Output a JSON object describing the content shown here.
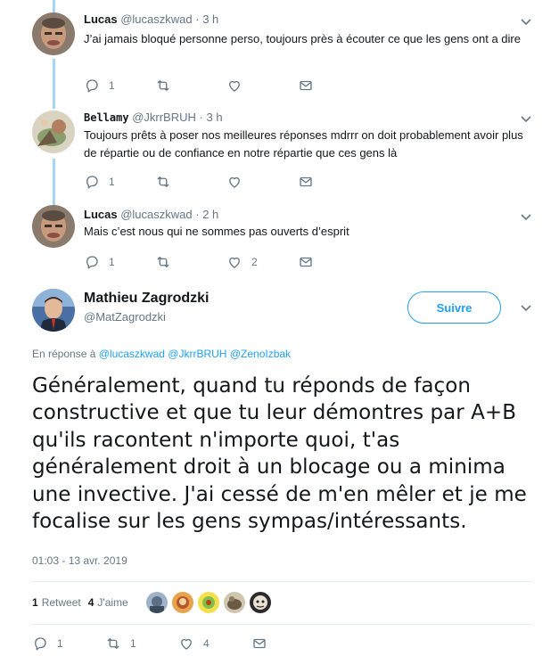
{
  "replies": [
    {
      "name": "Lucas",
      "handle": "@lucaszkwad",
      "dot": "·",
      "time": "3 h",
      "text": "J’ai jamais bloqué personne perso, toujours près à écouter ce que les gens ont a dire",
      "replies_count": "1",
      "retweets_count": "",
      "likes_count": ""
    },
    {
      "name": "Bellamy",
      "handle": "@JkrrBRUH",
      "dot": "·",
      "time": "3 h",
      "text": "Toujours prêts à poser nos meilleures réponses mdrrr on doit probablement avoir plus de répartie ou de confiance en notre répartie que ces gens là",
      "replies_count": "1",
      "retweets_count": "",
      "likes_count": ""
    },
    {
      "name": "Lucas",
      "handle": "@lucaszkwad",
      "dot": "·",
      "time": "2 h",
      "text": "Mais c’est nous qui ne sommes pas ouverts d’esprit",
      "replies_count": "1",
      "retweets_count": "",
      "likes_count": "2"
    }
  ],
  "main": {
    "name": "Mathieu Zagrodzki",
    "handle": "@MatZagrodzki",
    "follow_label": "Suivre",
    "in_reply_prefix": "En réponse à",
    "mentions": [
      "@lucaszkwad",
      "@JkrrBRUH",
      "@ZenoIzbak"
    ],
    "text": "Généralement, quand tu réponds de façon constructive et que tu leur démontres par A+B qu'ils racontent n'importe quoi, t'as généralement droit à un blocage ou a minima une invective. J'ai cessé de m'en mêler et je me focalise sur les gens sympas/intéressants.",
    "datetime": "01:03 - 13 avr. 2019",
    "retweets_num": "1",
    "retweets_label": "Retweet",
    "likes_num": "4",
    "likes_label": "J'aime",
    "replies_count": "1",
    "retweets_count": "1",
    "likes_count": "4"
  },
  "colors": {
    "accent": "#1da1f2",
    "thread": "#a5d6f5",
    "muted": "#657786"
  }
}
